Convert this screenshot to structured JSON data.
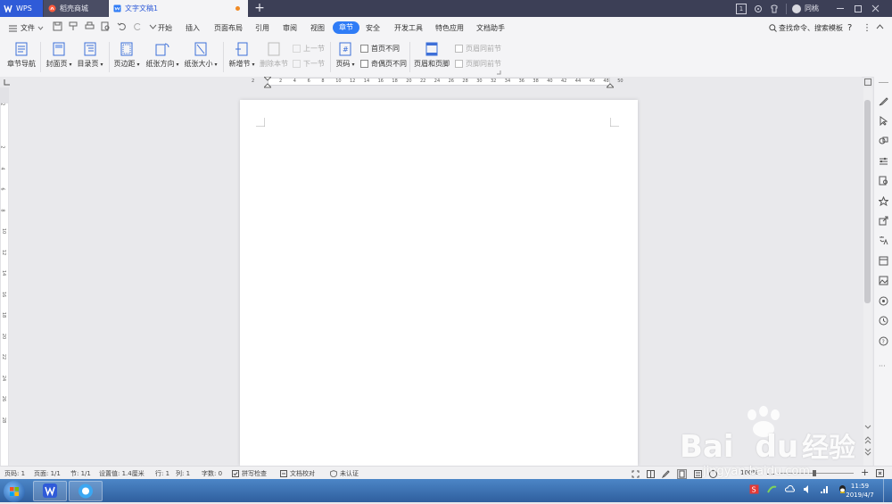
{
  "titlebar": {
    "tabs": [
      {
        "label": "WPS"
      },
      {
        "label": "稻壳商城"
      },
      {
        "label": "文字文稿1"
      }
    ],
    "badge": "1",
    "user": "同桃"
  },
  "menu": {
    "file": "文件",
    "items": [
      "开始",
      "插入",
      "页面布局",
      "引用",
      "审阅",
      "视图",
      "章节",
      "安全",
      "开发工具",
      "特色应用",
      "文档助手"
    ],
    "search": "查找命令、搜索模板",
    "help": "?"
  },
  "ribbon": {
    "chapter_nav": "章节导航",
    "cover": "封面页",
    "toc": "目录页",
    "margins": "页边距",
    "orientation": "纸张方向",
    "size": "纸张大小",
    "new_section": "新增节",
    "delete_section": "删除本节",
    "prev_section": "上一节",
    "next_section": "下一节",
    "page_number": "页码",
    "first_diff": "首页不同",
    "odd_even_diff": "奇偶页不同",
    "header_footer": "页眉和页脚",
    "header_same": "页眉同前节",
    "footer_same": "页脚同前节"
  },
  "ruler": {
    "h_numbers": [
      "2",
      "2",
      "4",
      "6",
      "8",
      "10",
      "12",
      "14",
      "16",
      "18",
      "20",
      "22",
      "24",
      "26",
      "28",
      "30",
      "32",
      "34",
      "36",
      "38",
      "40",
      "42",
      "44",
      "46",
      "48",
      "50"
    ],
    "v_numbers": [
      "2",
      "2",
      "4",
      "6",
      "8",
      "10",
      "12",
      "14",
      "16",
      "18",
      "20",
      "22",
      "24",
      "26",
      "28"
    ]
  },
  "status": {
    "page_no": "页码: 1",
    "pages": "页面: 1/1",
    "section": "节: 1/1",
    "setting": "设置值: 1.4厘米",
    "row": "行: 1",
    "col": "列: 1",
    "words": "字数: 0",
    "spell": "拼写检查",
    "proof": "文档校对",
    "auth": "未认证",
    "zoom": "100%"
  },
  "taskbar": {
    "time": "11:59",
    "date": "2019/4/7"
  },
  "watermark": {
    "brand": "Bai",
    "brand2": "du",
    "cn": "经验",
    "url": "jingyan.baidu.com"
  },
  "colors": {
    "accent": "#2f7cf6",
    "titlebar": "#3c3f56",
    "wps_tab": "#2f5bd8"
  }
}
